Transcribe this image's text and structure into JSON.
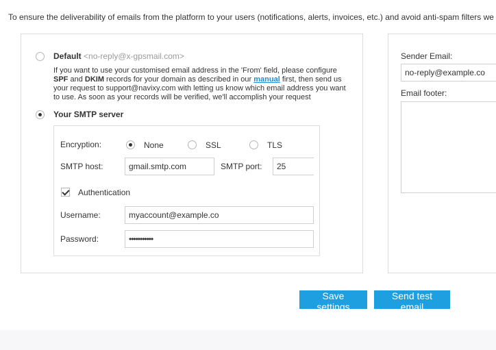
{
  "intro_text": "To ensure the deliverability of emails from the platform to your users (notifications, alerts, invoices, etc.) and avoid anti-spam filters we offe",
  "default_option": {
    "label": "Default",
    "sender": "<no-reply@x-gpsmail.com>",
    "selected": false,
    "desc_line1": "If you want to use your customised email address in the 'From' field, please configure",
    "desc_spf": "SPF",
    "desc_and": " and ",
    "desc_dkim": "DKIM",
    "desc_line2_mid": " records for your domain as described in our ",
    "desc_link": "manual",
    "desc_line2_end": " first, then send us",
    "desc_line3": "your request to support@navixy.com with letting us know which email address you want",
    "desc_line4": "to use. As soon as your records will be verified, we'll accomplish your request"
  },
  "smtp_option": {
    "label": "Your SMTP server",
    "selected": true
  },
  "smtp": {
    "encryption_label": "Encryption:",
    "encryption_options": [
      "None",
      "SSL",
      "TLS"
    ],
    "encryption_selected": "None",
    "host_label": "SMTP host:",
    "host_value": "gmail.smtp.com",
    "port_label": "SMTP port:",
    "port_value": "25",
    "auth_label": "Authentication",
    "auth_checked": true,
    "username_label": "Username:",
    "username_value": "myaccount@example.co",
    "password_label": "Password:",
    "password_value": "•••••••••••"
  },
  "right_panel": {
    "sender_label": "Sender Email:",
    "sender_value": "no-reply@example.co",
    "footer_label": "Email footer:",
    "footer_value": ""
  },
  "buttons": {
    "save": "Save settings",
    "test": "Send test email"
  },
  "colors": {
    "accent": "#1e9fe0",
    "link": "#1e8ed6",
    "border": "#dcdcdc"
  }
}
